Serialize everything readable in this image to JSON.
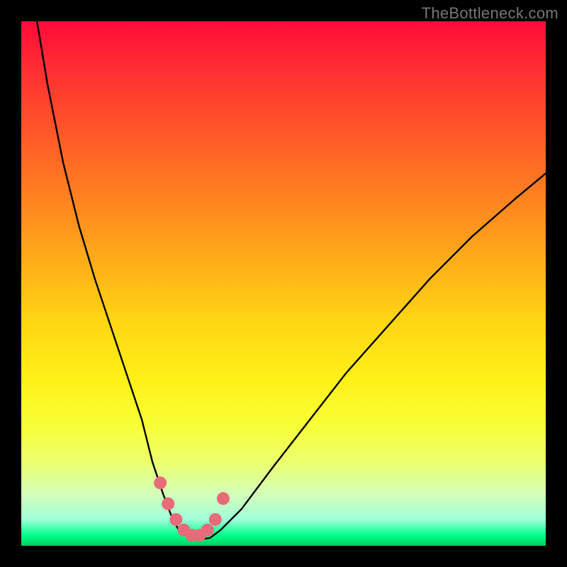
{
  "watermark": "TheBottleneck.com",
  "chart_data": {
    "type": "line",
    "title": "",
    "xlabel": "",
    "ylabel": "",
    "xlim": [
      0,
      100
    ],
    "ylim": [
      0,
      100
    ],
    "curve": {
      "name": "bottleneck-curve",
      "color": "#000000",
      "x": [
        3,
        5,
        8,
        11,
        14,
        17,
        20,
        23,
        25,
        27,
        28.5,
        30,
        32,
        34,
        36,
        38,
        42,
        48,
        55,
        62,
        70,
        78,
        86,
        94,
        100
      ],
      "y": [
        100,
        88,
        73,
        61,
        51,
        42,
        33,
        24,
        16,
        10,
        6,
        3,
        1.5,
        1.2,
        1.5,
        3,
        7,
        15,
        24,
        33,
        42,
        51,
        59,
        66,
        71
      ]
    },
    "markers": {
      "name": "highlight-points",
      "color": "#e96a78",
      "x": [
        26.5,
        28,
        29.5,
        31,
        32.5,
        34,
        35.5,
        37,
        38.5
      ],
      "y": [
        12,
        8,
        5,
        3,
        2,
        2,
        3,
        5,
        9
      ]
    },
    "gradient_stops": [
      {
        "pos": 0,
        "color": "#ff0a3a"
      },
      {
        "pos": 22,
        "color": "#ff5a28"
      },
      {
        "pos": 48,
        "color": "#ffb518"
      },
      {
        "pos": 68,
        "color": "#fff017"
      },
      {
        "pos": 90,
        "color": "#d4ffb8"
      },
      {
        "pos": 100,
        "color": "#00d060"
      }
    ]
  }
}
